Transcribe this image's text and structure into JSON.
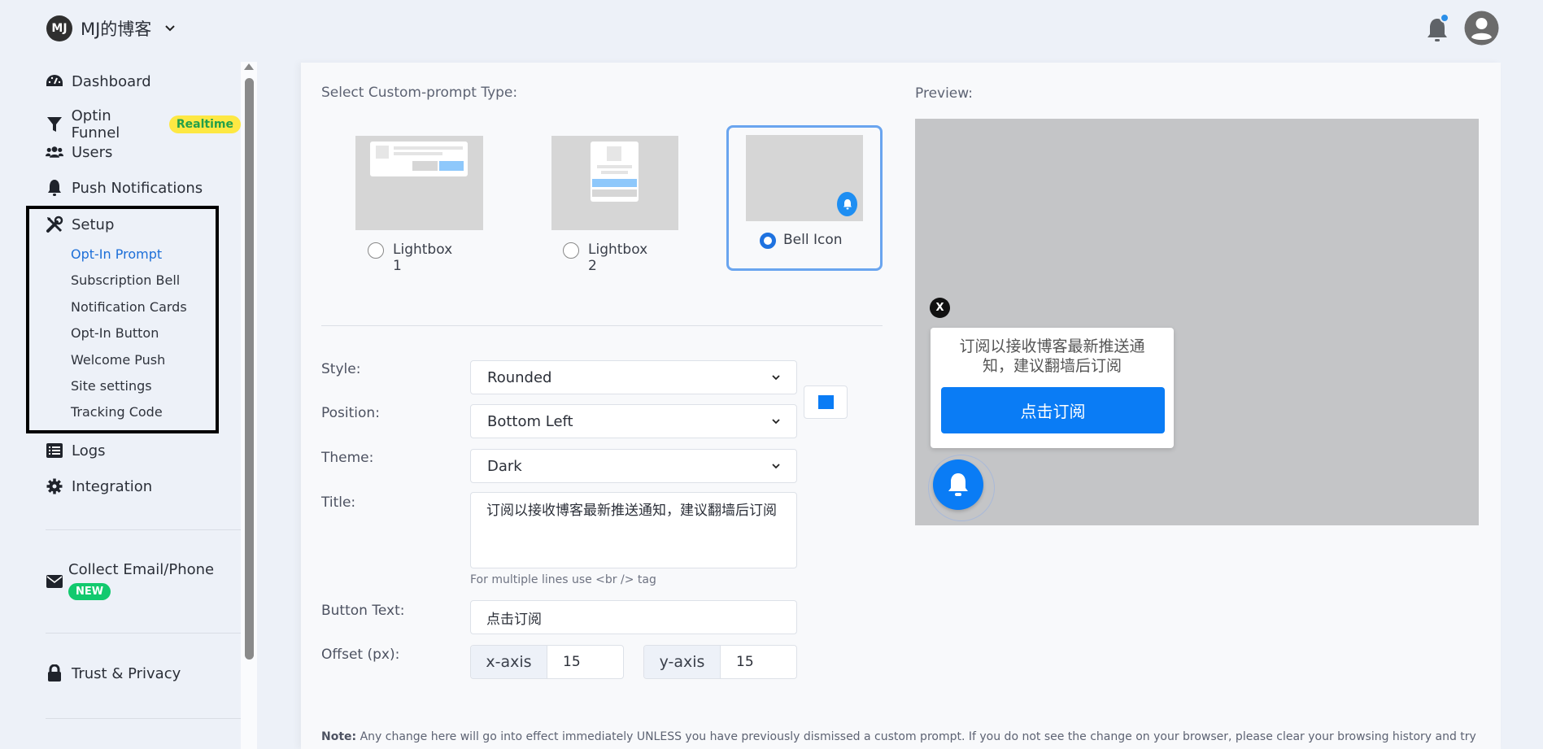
{
  "header": {
    "site_initials": "MJ",
    "site_name": "MJ的博客",
    "notification_dot_color": "#2a8ee8"
  },
  "sidebar": {
    "items": [
      {
        "label": "Dashboard",
        "icon": "dashboard-icon"
      },
      {
        "label": "Optin Funnel",
        "icon": "funnel-icon",
        "badge": "Realtime"
      },
      {
        "label": "Users",
        "icon": "users-icon"
      },
      {
        "label": "Push Notifications",
        "icon": "bell-icon"
      },
      {
        "label": "Setup",
        "icon": "tools-icon"
      },
      {
        "label": "Logs",
        "icon": "list-icon"
      },
      {
        "label": "Integration",
        "icon": "gear-icon"
      },
      {
        "label": "Collect Email/Phone",
        "icon": "envelope-icon",
        "badge": "NEW"
      },
      {
        "label": "Trust & Privacy",
        "icon": "lock-icon"
      }
    ],
    "setup_subitems": [
      {
        "label": "Opt-In Prompt",
        "active": true
      },
      {
        "label": "Subscription Bell"
      },
      {
        "label": "Notification Cards"
      },
      {
        "label": "Opt-In Button"
      },
      {
        "label": "Welcome Push"
      },
      {
        "label": "Site settings"
      },
      {
        "label": "Tracking Code"
      }
    ]
  },
  "main": {
    "type_label": "Select Custom-prompt Type:",
    "types": [
      {
        "label": "Lightbox 1",
        "selected": false
      },
      {
        "label": "Lightbox 2",
        "selected": false
      },
      {
        "label": "Bell Icon",
        "selected": true
      }
    ],
    "form": {
      "style_label": "Style:",
      "style_value": "Rounded",
      "position_label": "Position:",
      "position_value": "Bottom Left",
      "theme_label": "Theme:",
      "theme_value": "Dark",
      "theme_color": "#0a7cf5",
      "title_label": "Title:",
      "title_value": "订阅以接收博客最新推送通知，建议翻墙后订阅",
      "title_hint": "For multiple lines use <br /> tag",
      "button_text_label": "Button Text:",
      "button_text_value": "点击订阅",
      "offset_label": "Offset (px):",
      "x_axis_label": "x-axis",
      "x_axis_value": "15",
      "y_axis_label": "y-axis",
      "y_axis_value": "15"
    },
    "note_label": "Note:",
    "note_text": " Any change here will go into effect immediately UNLESS you have previously dismissed a custom prompt. If you do not see the change on your browser, please clear your browsing history and try"
  },
  "preview": {
    "label": "Preview:",
    "close_label": "X",
    "title": "订阅以接收博客最新推送通知，建议翻墙后订阅",
    "button": "点击订阅"
  }
}
